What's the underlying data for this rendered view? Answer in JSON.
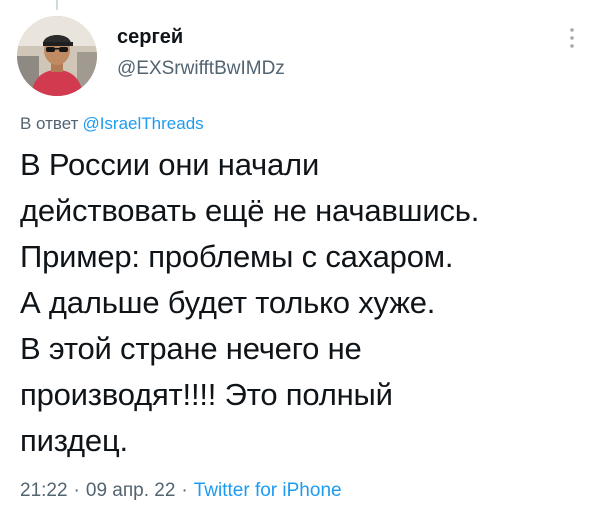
{
  "author": {
    "display_name": "сергей",
    "handle": "@EXSrwifftBwIMDz",
    "avatar_icon": "user-avatar-photo"
  },
  "reply": {
    "prefix": "В ответ",
    "mention": "@IsraelThreads"
  },
  "tweet": {
    "lines": [
      "В России они начали",
      "действовать ещё не начавшись.",
      "Пример: проблемы с сахаром.",
      "А дальше будет только хуже.",
      "В этой стране нечего не",
      "производят!!!! Это полный",
      "пиздец."
    ]
  },
  "meta": {
    "time": "21:22",
    "separator": "·",
    "date": "09 апр. 22",
    "source": "Twitter for iPhone"
  },
  "icons": {
    "more": "more-vertical-icon"
  },
  "colors": {
    "text": "#0f1419",
    "secondary": "#536471",
    "accent": "#1d9bf0"
  }
}
